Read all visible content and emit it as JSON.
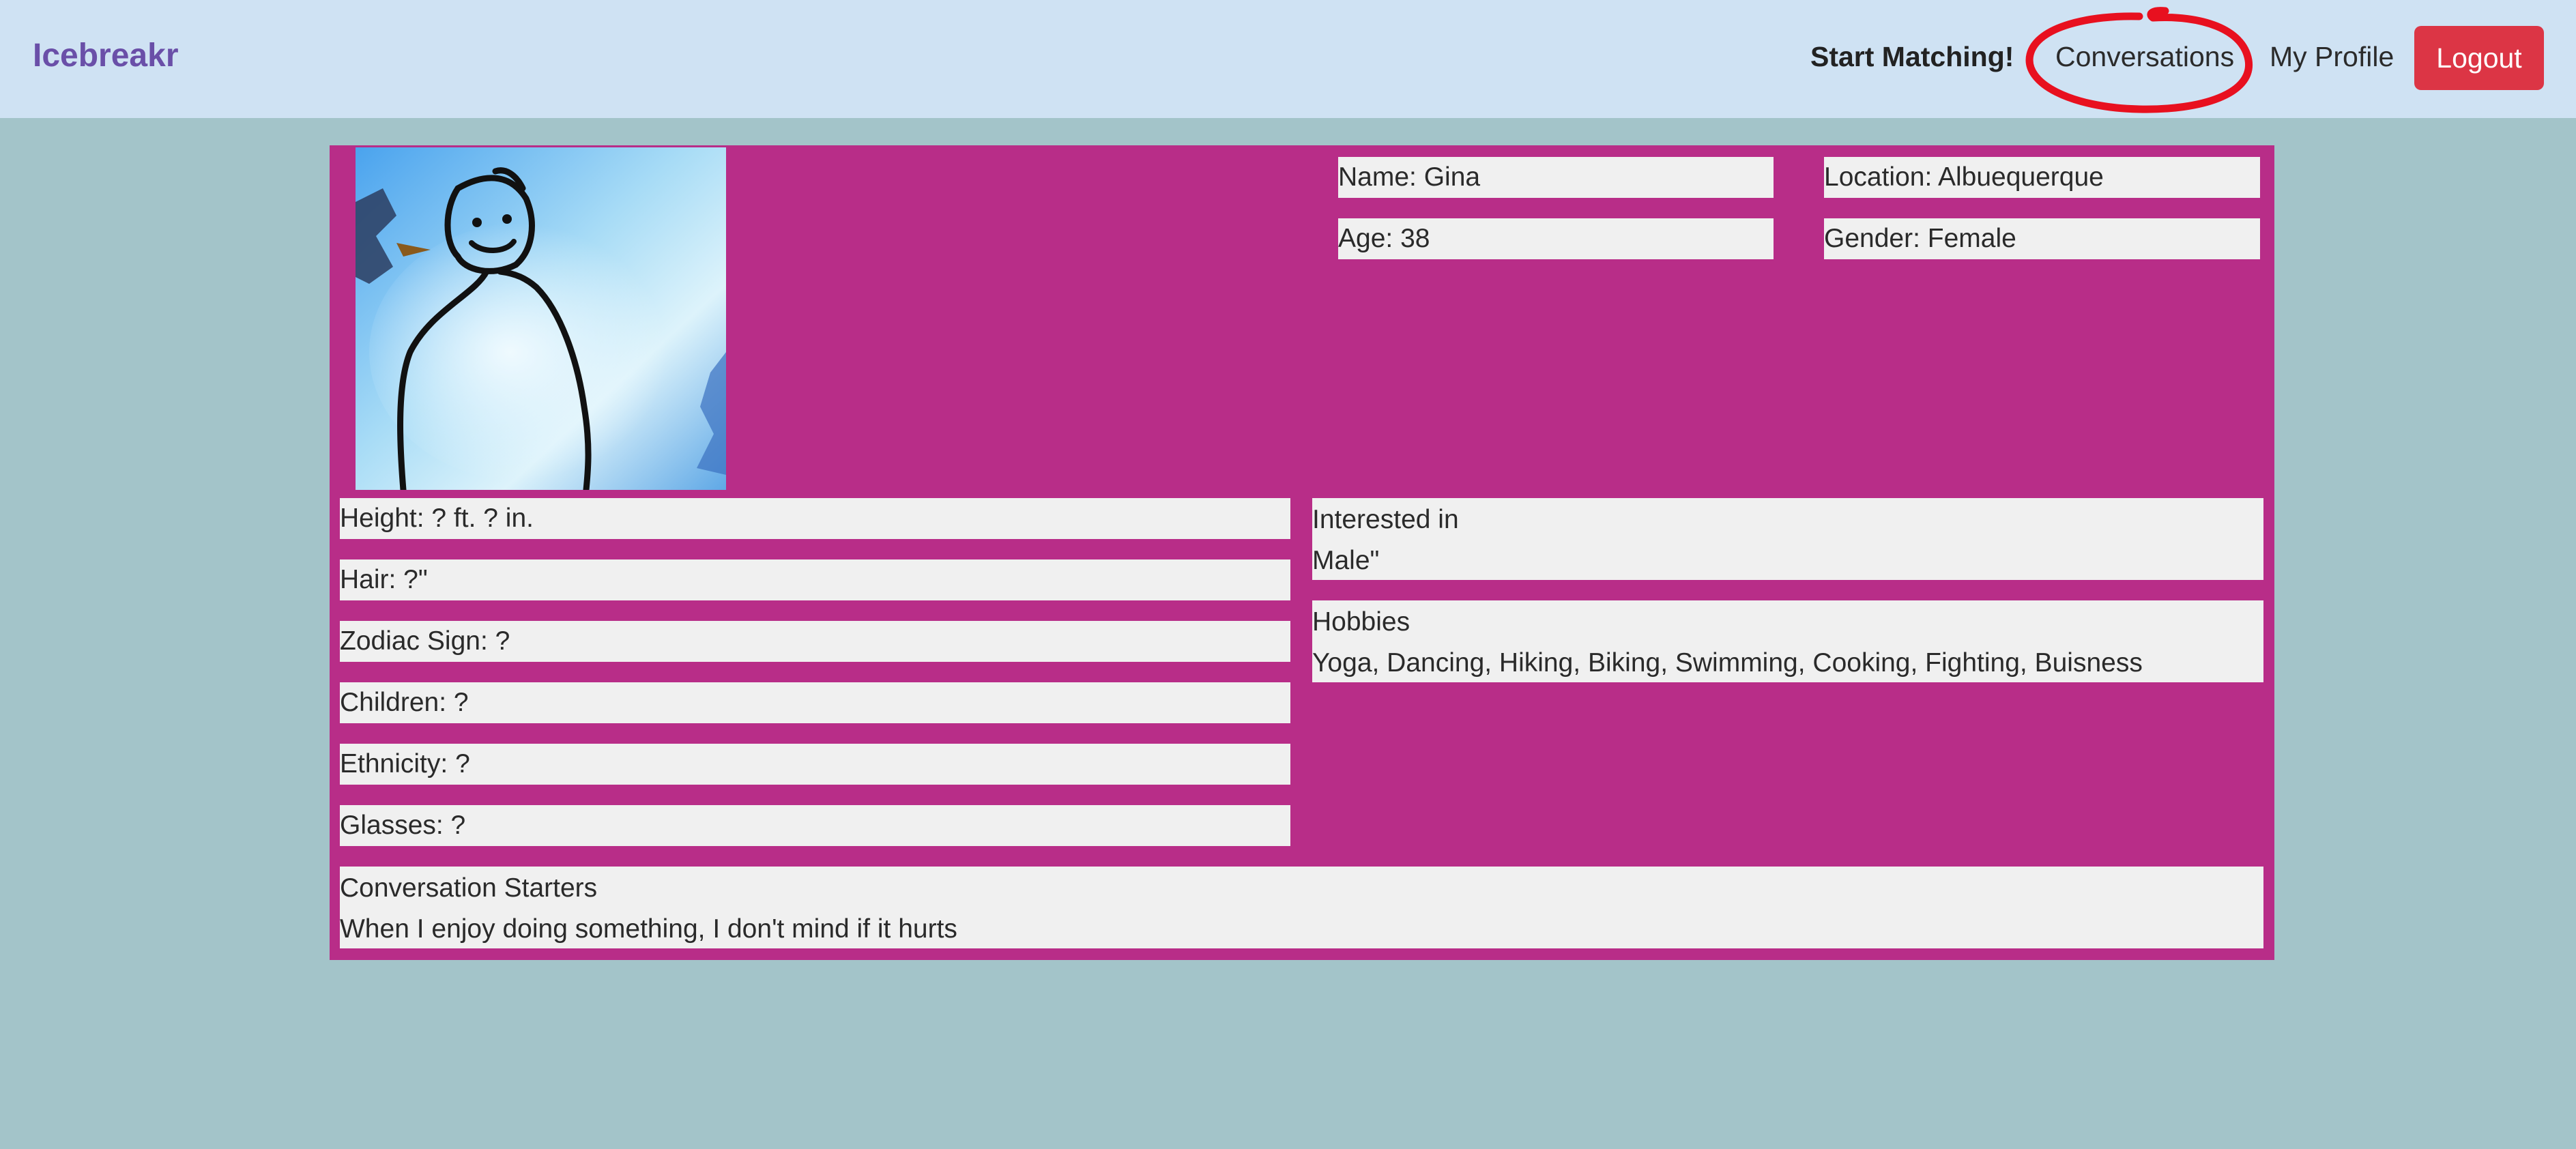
{
  "navbar": {
    "brand": "Icebreakr",
    "links": {
      "start_matching": "Start Matching!",
      "conversations": "Conversations",
      "my_profile": "My Profile",
      "logout": "Logout"
    },
    "colors": {
      "background": "#cfe2f3",
      "brand": "#6a4fa8",
      "logout": "#dc3545",
      "annotation": "#e8101f"
    }
  },
  "profile": {
    "card_color": "#b82d88",
    "page_background": "#a3c4c9",
    "photo_icon": "stick-figure-drawing",
    "name": "Name: Gina",
    "location": "Location: Albuequerque",
    "age": "Age: 38",
    "gender": "Gender: Female",
    "details": {
      "height": "Height: ? ft. ? in.",
      "hair": "Hair: ?\"",
      "zodiac": "Zodiac Sign: ?",
      "children": "Children: ?",
      "ethnicity": "Ethnicity: ?",
      "glasses": "Glasses: ?"
    },
    "interested_in": {
      "title": "Interested in",
      "value": "Male\""
    },
    "hobbies": {
      "title": "Hobbies",
      "value": "Yoga, Dancing, Hiking, Biking, Swimming, Cooking, Fighting, Buisness"
    },
    "conversation_starters": {
      "title": "Conversation Starters",
      "value": "When I enjoy doing something, I don't mind if it hurts"
    }
  }
}
